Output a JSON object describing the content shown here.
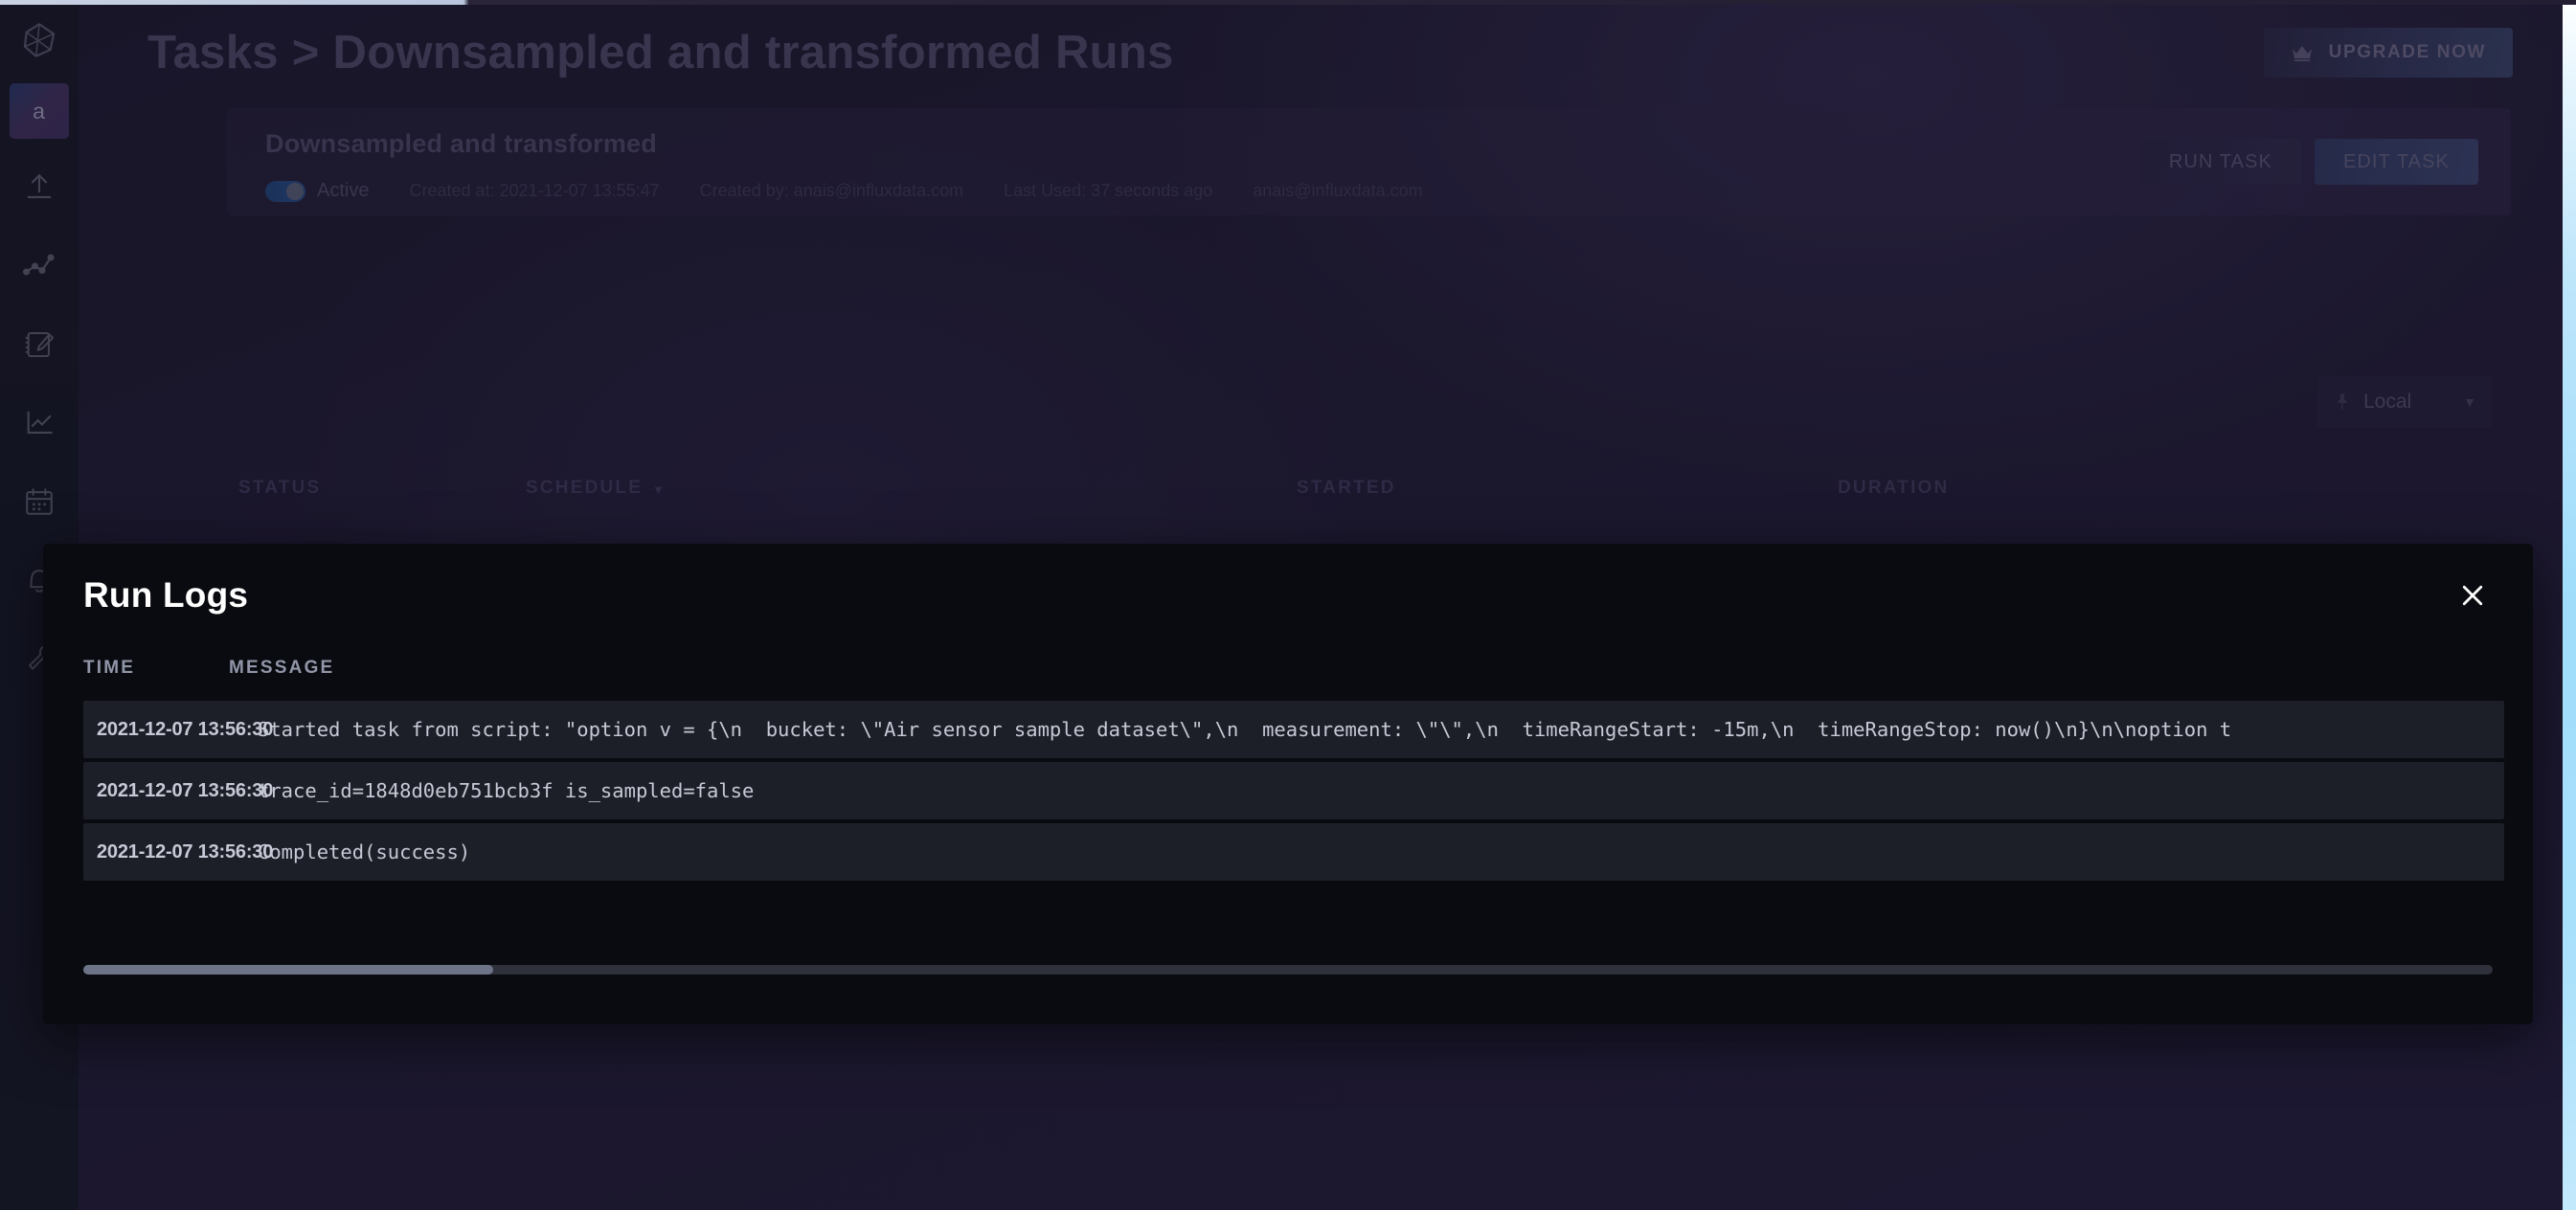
{
  "theme": {
    "accent_blue": "#3d4570",
    "page_bg": "#251f3a",
    "modal_bg": "#0a0b10",
    "row_bg": "#1d1f28",
    "text_bright": "#c6cad6"
  },
  "sidebar": {
    "logo_icon": "influxdb-logo-icon",
    "org_initial": "a",
    "items": [
      {
        "icon": "load-data-upload-icon",
        "name": "load-data"
      },
      {
        "icon": "data-explorer-line-icon",
        "name": "data-explorer"
      },
      {
        "icon": "notebook-pencil-icon",
        "name": "notebooks"
      },
      {
        "icon": "dashboards-chart-icon",
        "name": "dashboards"
      },
      {
        "icon": "tasks-calendar-icon",
        "name": "tasks"
      },
      {
        "icon": "alerts-bell-icon",
        "name": "alerts"
      },
      {
        "icon": "settings-wrench-icon",
        "name": "settings"
      }
    ]
  },
  "header": {
    "breadcrumb": "Tasks > Downsampled and transformed Runs",
    "upgrade_label": "UPGRADE NOW",
    "upgrade_icon": "crown-icon"
  },
  "task_card": {
    "name": "Downsampled and transformed",
    "status_label": "Active",
    "status_active": true,
    "created_at": "Created at: 2021-12-07 13:55:47",
    "created_by": "Created by: anais@influxdata.com",
    "last_used": "Last Used: 37 seconds ago",
    "owner_email": "anais@influxdata.com",
    "run_task_label": "RUN TASK",
    "edit_task_label": "EDIT TASK"
  },
  "timezone": {
    "icon": "pin-icon",
    "value": "Local",
    "chevron": "▼"
  },
  "runs_table": {
    "columns": [
      "STATUS",
      "SCHEDULE",
      "STARTED",
      "DURATION"
    ],
    "sort_caret": "▼"
  },
  "modal": {
    "title": "Run Logs",
    "close_icon": "close-icon",
    "columns": {
      "time": "TIME",
      "message": "MESSAGE"
    },
    "rows": [
      {
        "time": "2021-12-07 13:56:30",
        "message": "Started task from script: \"option v = {\\n  bucket: \\\"Air sensor sample dataset\\\",\\n  measurement: \\\"\\\",\\n  timeRangeStart: -15m,\\n  timeRangeStop: now()\\n}\\n\\noption t"
      },
      {
        "time": "2021-12-07 13:56:30",
        "message": "trace_id=1848d0eb751bcb3f is_sampled=false"
      },
      {
        "time": "2021-12-07 13:56:30",
        "message": "Completed(success)"
      }
    ],
    "hscroll_thumb_percent": 17
  }
}
